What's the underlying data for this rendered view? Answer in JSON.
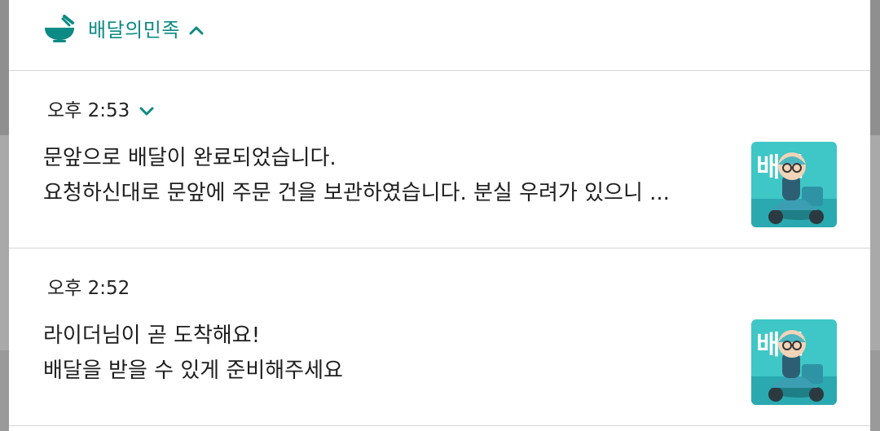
{
  "app": {
    "name": "배달의민족",
    "icon": "bowl-with-spoon-icon",
    "accent_color": "#0c8a84"
  },
  "notifications": [
    {
      "time": "오후 2:53",
      "title": "문앞으로 배달이 완료되었습니다.",
      "body": "요청하신대로 문앞에 주문 건을 보관하였습니다. 분실 우려가 있으니 ...",
      "thumbnail_text": "배민",
      "expandable": true
    },
    {
      "time": "오후 2:52",
      "title": "라이더님이 곧 도착해요!",
      "body": "배달을 받을 수 있게 준비해주세요",
      "thumbnail_text": "배민",
      "expandable": false
    }
  ]
}
